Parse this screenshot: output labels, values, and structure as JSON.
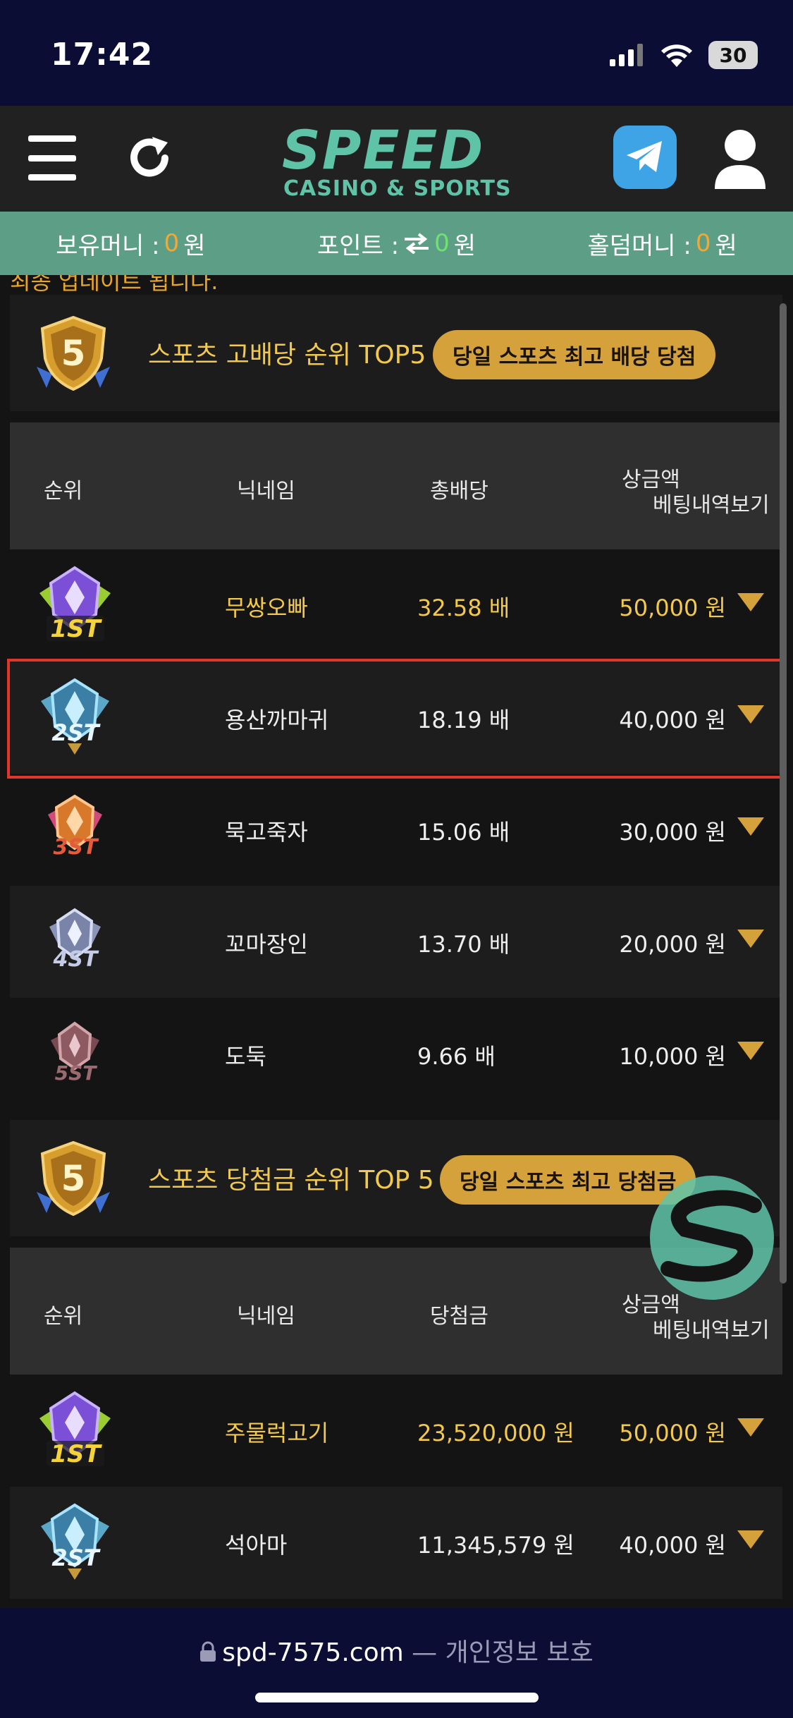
{
  "status": {
    "time": "17:42",
    "battery": "30"
  },
  "header": {
    "logo_main": "SPEED",
    "logo_sub": "CASINO & SPORTS"
  },
  "balance": {
    "money_label": "보유머니 :",
    "money_value": "0",
    "money_unit": "원",
    "point_label": "포인트 :",
    "point_value": "0",
    "point_unit": "원",
    "holdem_label": "홀덤머니 :",
    "holdem_value": "0",
    "holdem_unit": "원"
  },
  "ticker": "최종 업데이트 됩니다.",
  "colors": {
    "accent_green": "#5fc3a8",
    "gold": "#f2c94c",
    "pill": "#d4a13a",
    "highlight": "#e0362b"
  },
  "section1": {
    "title": "스포츠 고배당 순위 TOP5",
    "pill": "당일 스포츠 최고 배당 당첨",
    "headers": {
      "rank": "순위",
      "nick": "닉네임",
      "metric": "총배당",
      "prize": "상금액",
      "history": "베팅내역보기"
    },
    "rows": [
      {
        "rank": "1ST",
        "nick": "무쌍오빠",
        "metric": "32.58 배",
        "prize": "50,000 원"
      },
      {
        "rank": "2ST",
        "nick": "용산까마귀",
        "metric": "18.19 배",
        "prize": "40,000 원"
      },
      {
        "rank": "3ST",
        "nick": "묵고죽자",
        "metric": "15.06 배",
        "prize": "30,000 원"
      },
      {
        "rank": "4ST",
        "nick": "꼬마장인",
        "metric": "13.70 배",
        "prize": "20,000 원"
      },
      {
        "rank": "5ST",
        "nick": "도둑",
        "metric": "9.66 배",
        "prize": "10,000 원"
      }
    ]
  },
  "section2": {
    "title": "스포츠 당첨금 순위 TOP 5",
    "pill": "당일 스포츠 최고 당첨금",
    "headers": {
      "rank": "순위",
      "nick": "닉네임",
      "metric": "당첨금",
      "prize": "상금액",
      "history": "베팅내역보기"
    },
    "rows": [
      {
        "rank": "1ST",
        "nick": "주물럭고기",
        "metric": "23,520,000 원",
        "prize": "50,000 원"
      },
      {
        "rank": "2ST",
        "nick": "석아마",
        "metric": "11,345,579 원",
        "prize": "40,000 원"
      }
    ]
  },
  "url_bar": {
    "domain": "spd-7575.com",
    "suffix": "— 개인정보 보호"
  }
}
